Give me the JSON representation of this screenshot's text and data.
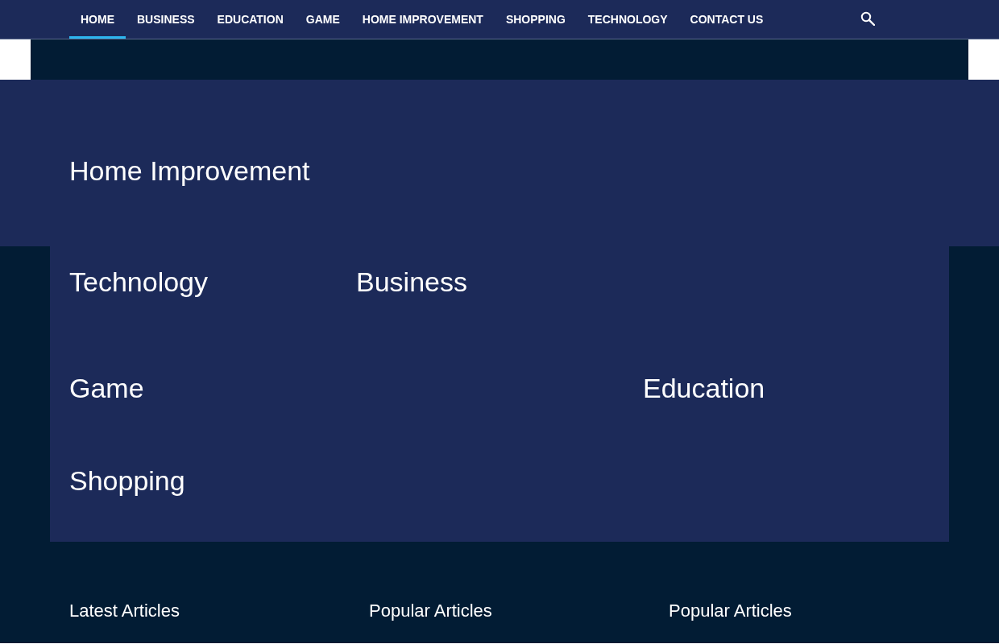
{
  "nav": {
    "items": [
      {
        "label": "HOME",
        "selected": true
      },
      {
        "label": "BUSINESS",
        "selected": false
      },
      {
        "label": "EDUCATION",
        "selected": false
      },
      {
        "label": "GAME",
        "selected": false
      },
      {
        "label": "HOME IMPROVEMENT",
        "selected": false
      },
      {
        "label": "SHOPPING",
        "selected": false
      },
      {
        "label": "TECHNOLOGY",
        "selected": false
      },
      {
        "label": "CONTACT US",
        "selected": false
      }
    ]
  },
  "hero": {
    "title": "Home Improvement"
  },
  "categories": [
    {
      "title": "Technology"
    },
    {
      "title": "Business"
    },
    {
      "title": "Game"
    },
    {
      "title": "Education"
    },
    {
      "title": "Shopping"
    }
  ],
  "footer": {
    "columns": [
      {
        "title": "Latest Articles"
      },
      {
        "title": "Popular Articles"
      },
      {
        "title": "Popular Articles"
      }
    ]
  }
}
